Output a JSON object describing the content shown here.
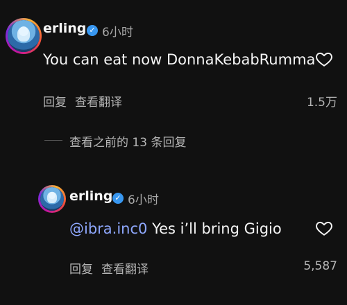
{
  "comment": {
    "username": "erling",
    "time": "6小时",
    "text": "You can eat now DonnaKebabRumma",
    "reply_label": "回复",
    "translate_label": "查看翻译",
    "like_count": "1.5万"
  },
  "view_previous": "查看之前的 13 条回复",
  "reply": {
    "username": "erling",
    "time": "6小时",
    "mention": "@ibra.inc0",
    "text": " Yes i’ll bring Gigio",
    "reply_label": "回复",
    "translate_label": "查看翻译",
    "like_count": "5,587"
  },
  "colors": {
    "background": "#111111",
    "verified": "#3897f0",
    "mention": "#8fa8ff"
  }
}
